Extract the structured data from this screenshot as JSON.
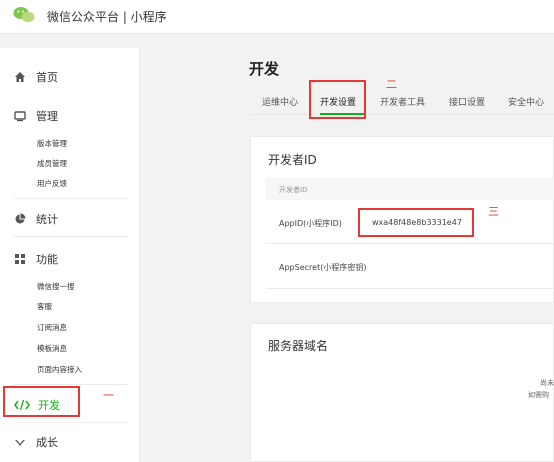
{
  "header": {
    "brand": "微信公众平台 | 小程序",
    "logo_icon": "wechat-logo-icon"
  },
  "sidebar": {
    "home": "首页",
    "manage": "管理",
    "manage_items": [
      "版本管理",
      "成员管理",
      "用户反馈"
    ],
    "stats": "统计",
    "features": "功能",
    "feature_items": [
      "微信搜一搜",
      "客服",
      "订阅消息",
      "模板消息",
      "页面内容接入"
    ],
    "develop": "开发",
    "growth": "成长"
  },
  "page": {
    "title": "开发"
  },
  "tabs": [
    "运维中心",
    "开发设置",
    "开发者工具",
    "接口设置",
    "安全中心"
  ],
  "active_tab": "开发设置",
  "dev_id": {
    "title": "开发者ID",
    "column_header": "开发者ID",
    "appid_label": "AppID(小程序ID)",
    "appid_value": "wxa48f48e8b3331e47",
    "appsecret_label": "AppSecret(小程序密钥)"
  },
  "server_domain": {
    "title": "服务器域名",
    "partial_line1": "尚未",
    "partial_line2": "如需购"
  },
  "annotations": {
    "one": "一",
    "two": "二",
    "three": "三"
  },
  "colors": {
    "accent": "#1aad19",
    "annotation": "#e53935"
  }
}
